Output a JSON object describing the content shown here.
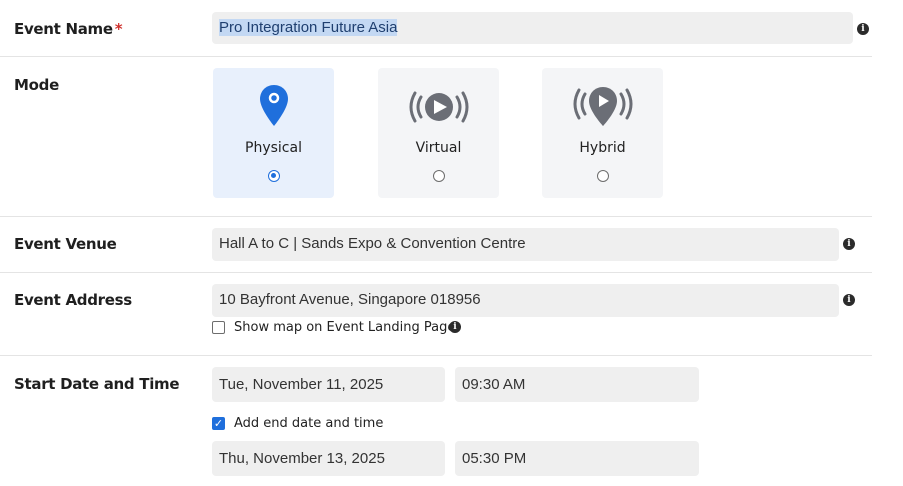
{
  "event_name": {
    "label": "Event Name",
    "required_mark": "*",
    "value": "Pro Integration Future Asia"
  },
  "mode": {
    "label": "Mode",
    "options": [
      {
        "label": "Physical",
        "icon": "map-pin-icon",
        "selected": true
      },
      {
        "label": "Virtual",
        "icon": "broadcast-play-icon",
        "selected": false
      },
      {
        "label": "Hybrid",
        "icon": "broadcast-pin-icon",
        "selected": false
      }
    ],
    "accent_color": "#1f6fdc"
  },
  "venue": {
    "label": "Event Venue",
    "value": "Hall A to C | Sands Expo & Convention Centre"
  },
  "address": {
    "label": "Event Address",
    "value": "10 Bayfront Avenue, Singapore 018956",
    "show_map_label": "Show map on Event Landing Page",
    "show_map_checked": false
  },
  "start": {
    "label": "Start Date and Time",
    "date": "Tue, November 11, 2025",
    "time": "09:30 AM"
  },
  "end": {
    "checkbox_label": "Add end date and time",
    "checked": true,
    "date": "Thu, November 13, 2025",
    "time": "05:30 PM"
  },
  "info_glyph": "i"
}
